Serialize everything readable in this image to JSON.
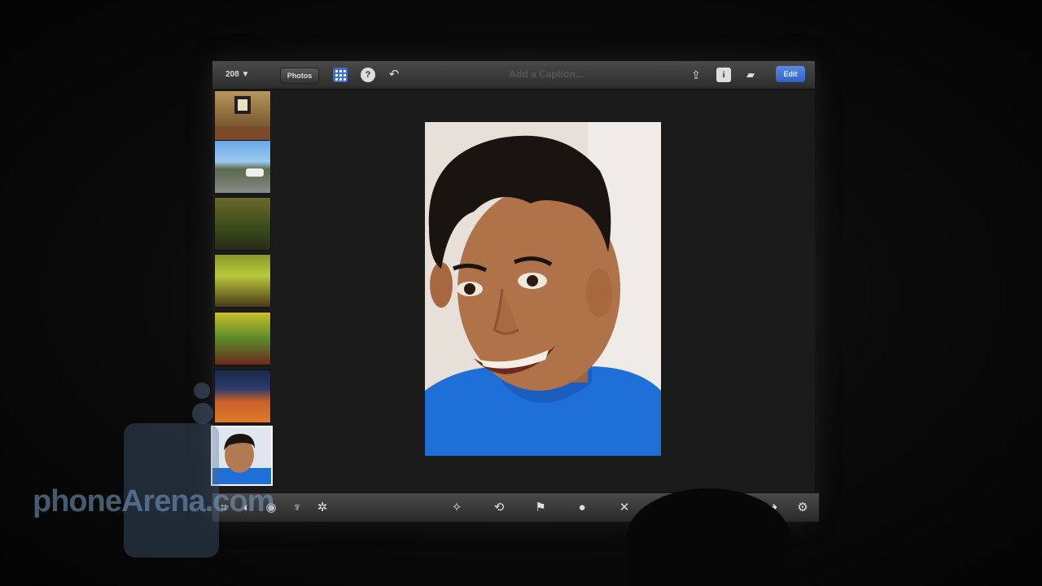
{
  "topbar": {
    "photo_count": "208 ▼",
    "photos_button": "Photos",
    "grid_icon": "grid-icon",
    "help_icon_glyph": "?",
    "undo_icon_glyph": "↶",
    "caption_placeholder": "Add a Caption...",
    "share_icon_glyph": "⇪",
    "info_icon_glyph": "i",
    "folder_icon_glyph": "▰",
    "edit_button": "Edit"
  },
  "bottombar": {
    "left_icons": [
      "crop-icon",
      "exposure-icon",
      "color-icon",
      "brush-icon",
      "effects-icon"
    ],
    "left_glyphs": [
      "⌗",
      "◐",
      "◉",
      "♆",
      "✲"
    ],
    "center_icons": [
      "auto-enhance-icon",
      "rotate-icon",
      "flag-icon",
      "favorite-icon",
      "hide-icon"
    ],
    "center_glyphs": [
      "✧",
      "⟲",
      "⚑",
      "●",
      "✕"
    ],
    "right_icons": [
      "previous-icon",
      "next-icon",
      "settings-icon"
    ],
    "right_glyphs": [
      "←",
      "➜",
      "⚙"
    ]
  },
  "watermark": {
    "text": "phoneArena.com"
  },
  "colors": {
    "accent": "#3a6fd0",
    "shirt": "#1f6fd8",
    "background": "#1b1b1b"
  }
}
